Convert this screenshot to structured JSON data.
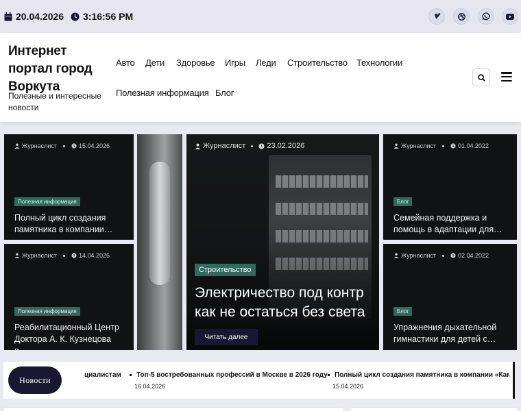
{
  "topbar": {
    "date": "20.04.2026",
    "time": "3:16:56 PM",
    "social_icons": [
      "vimeo-icon",
      "dribbble-icon",
      "whatsapp-icon",
      "youtube-icon"
    ]
  },
  "header": {
    "site_title": "Интернет портал город Воркута",
    "site_description": "Полезные и интересные новости",
    "nav": [
      "Авто",
      "Дети",
      "Здоровье",
      "Игры",
      "Леди",
      "Строительство",
      "Технологии",
      "Полезная информация",
      "Блог"
    ]
  },
  "cards": [
    {
      "author": "Журнаслист",
      "date": "15.04.2026",
      "category": "Полезная информация",
      "title": "Полный цикл создания памятника в компании…"
    },
    {
      "author": "Журнаслист",
      "date": "14.04.2026",
      "category": "Полезная информация",
      "title": "Реабилитационный Центр Доктора А. К. Кузнецова в…"
    },
    {
      "author": "Журнаслист",
      "date": "01.04.2022",
      "category": "Блог",
      "title": "Семейная поддержка и помощь в адаптации для…"
    },
    {
      "author": "Журнаслист",
      "date": "02.04.2022",
      "category": "Блог",
      "title": "Упражнения дыхательной гимнастики для детей с…"
    }
  ],
  "hero": {
    "author": "Журнаслист",
    "date": "23.02.2026",
    "category": "Строительство",
    "title_line1": "Электричество под контр",
    "title_line2": "как не остаться без света",
    "read_more": "Читать далее"
  },
  "ticker": {
    "label": "Новости",
    "items": [
      {
        "title": "циалистам",
        "date": ""
      },
      {
        "title": "Топ-5 востребованных профессий в Москве в 2026 году",
        "date": "16.04.2026"
      },
      {
        "title": "Полный цикл создания памятника в компании «Камни-",
        "date": "15.04.2026"
      }
    ]
  }
}
